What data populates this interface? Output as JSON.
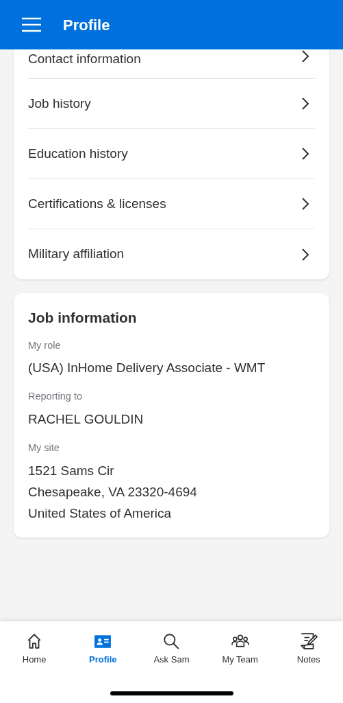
{
  "header": {
    "title": "Profile"
  },
  "profile_links": [
    {
      "label": "Contact information"
    },
    {
      "label": "Job history"
    },
    {
      "label": "Education history"
    },
    {
      "label": "Certifications & licenses"
    },
    {
      "label": "Military affiliation"
    }
  ],
  "job_information": {
    "title": "Job information",
    "fields": [
      {
        "label": "My role",
        "lines": [
          "(USA) InHome Delivery Associate - WMT"
        ]
      },
      {
        "label": "Reporting to",
        "lines": [
          "RACHEL GOULDIN"
        ]
      },
      {
        "label": "My site",
        "lines": [
          "1521 Sams Cir",
          "Chesapeake, VA 23320-4694",
          "United States of America"
        ]
      }
    ]
  },
  "tab_bar": [
    {
      "label": "Home",
      "kind": "home",
      "selected": false
    },
    {
      "label": "Profile",
      "kind": "profile",
      "selected": true
    },
    {
      "label": "Ask Sam",
      "kind": "search",
      "selected": false
    },
    {
      "label": "My Team",
      "kind": "team",
      "selected": false
    },
    {
      "label": "Notes",
      "kind": "notes",
      "selected": false
    }
  ]
}
